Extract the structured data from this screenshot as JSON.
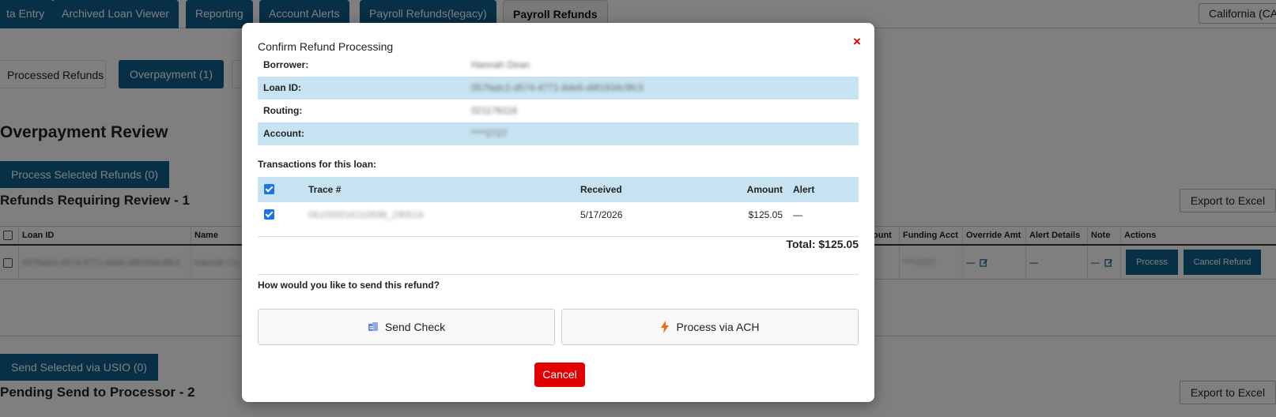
{
  "tabs": [
    {
      "label": "ta Entry"
    },
    {
      "label": "Archived Loan Viewer"
    },
    {
      "label": "Reporting"
    },
    {
      "label": "Account Alerts"
    },
    {
      "label": "Payroll Refunds(legacy)"
    },
    {
      "label": "Payroll Refunds"
    }
  ],
  "state_select": {
    "value": "California (CA"
  },
  "subtabs": {
    "processed": "Processed Refunds",
    "overpayment": "Overpayment (1)"
  },
  "review": {
    "heading": "Overpayment Review",
    "process_selected": "Process Selected Refunds (0)",
    "section_title": "Refunds Requiring Review - 1",
    "export": "Export to Excel",
    "columns": {
      "loan_id": "Loan ID",
      "name": "Name",
      "amount": "ount",
      "funding_acct": "Funding Acct",
      "override_amt": "Override Amt",
      "alert_details": "Alert Details",
      "note": "Note",
      "actions": "Actions"
    },
    "row": {
      "loan_id": "057fadc2-d574-4771-8de6-d9f1934c9fc3",
      "name": "Hannah Cra",
      "funding_acct": "****2727",
      "override_amt": "—",
      "alert_details": "—",
      "note": "—",
      "process": "Process",
      "cancel": "Cancel Refund"
    }
  },
  "pending": {
    "send_selected": "Send Selected via USIO (0)",
    "section_title": "Pending Send to Processor - 2",
    "export": "Export to Excel"
  },
  "modal": {
    "title": "Confirm Refund Processing",
    "close": "×",
    "info": [
      {
        "label": "Borrower:",
        "value": "Hannah Dean"
      },
      {
        "label": "Loan ID:",
        "value": "057fadc2-d574-4771-8de6-d9f1934c9fc3"
      },
      {
        "label": "Routing:",
        "value": "021176116"
      },
      {
        "label": "Account:",
        "value": "****2727"
      }
    ],
    "transactions_heading": "Transactions for this loan:",
    "columns": {
      "trace": "Trace #",
      "received": "Received",
      "amount": "Amount",
      "alert": "Alert"
    },
    "transaction": {
      "trace": "061000016110598_290516",
      "received": "5/17/2026",
      "amount": "$125.05",
      "alert": "—"
    },
    "total": "Total: $125.05",
    "send_question": "How would you like to send this refund?",
    "send_check": "Send Check",
    "process_ach": "Process via ACH",
    "cancel": "Cancel"
  },
  "colors": {
    "primary": "#0e5f8c",
    "header_shade": "#c7e3f1",
    "danger": "#e00000",
    "checkbox": "#1a73e8"
  },
  "icons": {
    "check_method": "check-payment-icon",
    "ach_method": "lightning-icon",
    "edit": "edit-icon"
  }
}
